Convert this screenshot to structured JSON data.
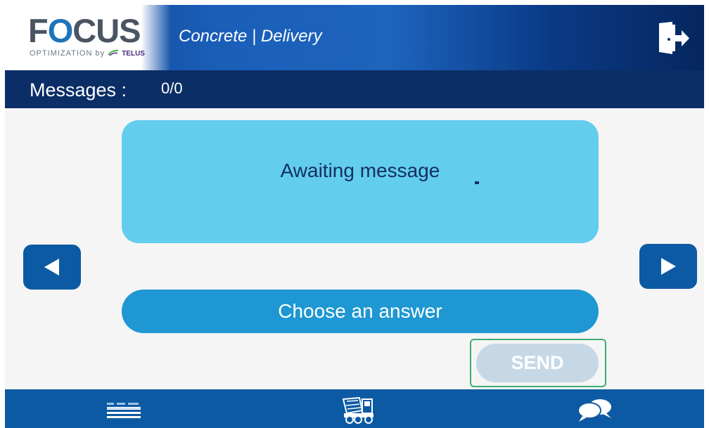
{
  "header": {
    "logo_text_f": "F",
    "logo_text_o": "O",
    "logo_text_rest": "CUS",
    "logo_subtitle": "OPTIMIZATION by",
    "logo_brand": "TELUS",
    "app_title": "Concrete | Delivery",
    "logout_icon": "logout-door-icon"
  },
  "messages": {
    "label": "Messages :",
    "count": "0/0"
  },
  "card": {
    "text": "Awaiting message"
  },
  "navigation": {
    "prev_icon": "triangle-left-icon",
    "next_icon": "triangle-right-icon"
  },
  "answer": {
    "label": "Choose an answer"
  },
  "send": {
    "label": "SEND",
    "state": "disabled"
  },
  "bottom_nav": {
    "items": [
      {
        "icon": "forms-list-icon"
      },
      {
        "icon": "concrete-truck-icon"
      },
      {
        "icon": "chat-bubbles-icon"
      }
    ]
  },
  "colors": {
    "header_dark": "#0b2e66",
    "header_blue": "#1d64bd",
    "card_bg": "#63cdee",
    "answer_bg": "#1e97d3",
    "nav_btn": "#0c5aa3",
    "send_disabled": "#c6d8e6",
    "focus_ring": "#3cae73"
  }
}
